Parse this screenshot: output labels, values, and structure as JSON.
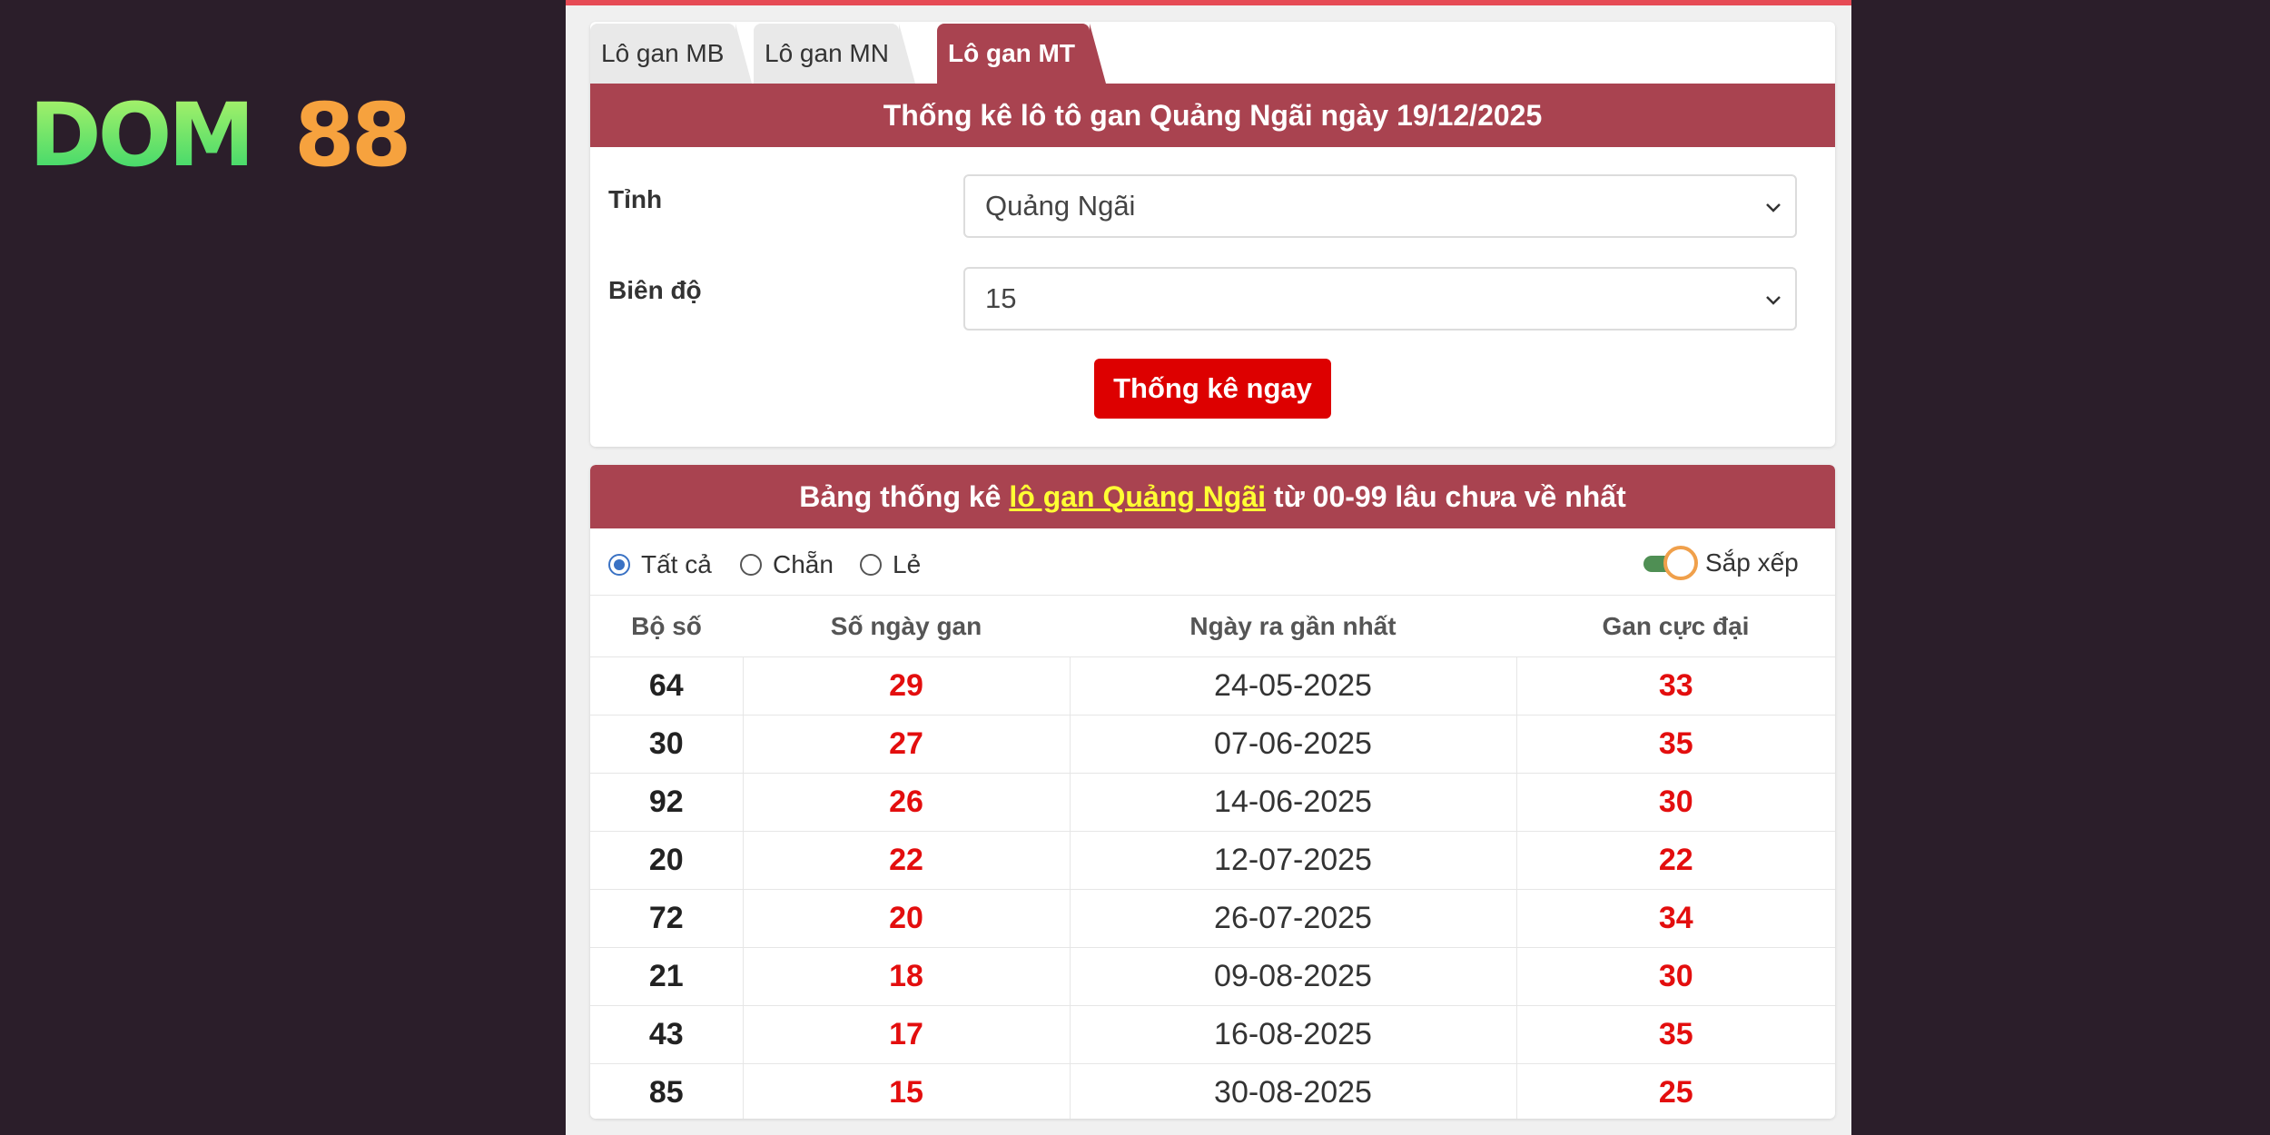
{
  "logo": {
    "brand_text": "DOM88",
    "colors": {
      "dom": "#3fe06e",
      "dom_light": "#b6f56a",
      "num": "#f6a23e"
    }
  },
  "tabs": [
    {
      "label": "Lô gan MB"
    },
    {
      "label": "Lô gan MN"
    },
    {
      "label": "Lô gan MT"
    }
  ],
  "form": {
    "title": "Thống kê lô tô gan Quảng Ngãi ngày 19/12/2025",
    "province_label": "Tỉnh",
    "province_value": "Quảng Ngãi",
    "range_label": "Biên độ",
    "range_value": "15",
    "submit_label": "Thống kê ngay"
  },
  "results": {
    "title_prefix": "Bảng thống kê ",
    "title_link": "lô gan Quảng Ngãi",
    "title_suffix": " từ 00-99 lâu chưa về nhất",
    "filters": [
      {
        "label": "Tất cả",
        "checked": true
      },
      {
        "label": "Chẵn",
        "checked": false
      },
      {
        "label": "Lẻ",
        "checked": false
      }
    ],
    "sort_label": "Sắp xếp",
    "sort_enabled": true,
    "columns": [
      "Bộ số",
      "Số ngày gan",
      "Ngày ra gần nhất",
      "Gan cực đại"
    ],
    "rows": [
      [
        "64",
        "29",
        "24-05-2025",
        "33"
      ],
      [
        "30",
        "27",
        "07-06-2025",
        "35"
      ],
      [
        "92",
        "26",
        "14-06-2025",
        "30"
      ],
      [
        "20",
        "22",
        "12-07-2025",
        "22"
      ],
      [
        "72",
        "20",
        "26-07-2025",
        "34"
      ],
      [
        "21",
        "18",
        "09-08-2025",
        "30"
      ],
      [
        "43",
        "17",
        "16-08-2025",
        "35"
      ],
      [
        "85",
        "15",
        "30-08-2025",
        "25"
      ]
    ]
  },
  "colors": {
    "background": "#2b1e2a",
    "header": "#a94350",
    "accent_red": "#e30e0e",
    "button": "#dd0000",
    "highlight": "#ffff33"
  }
}
